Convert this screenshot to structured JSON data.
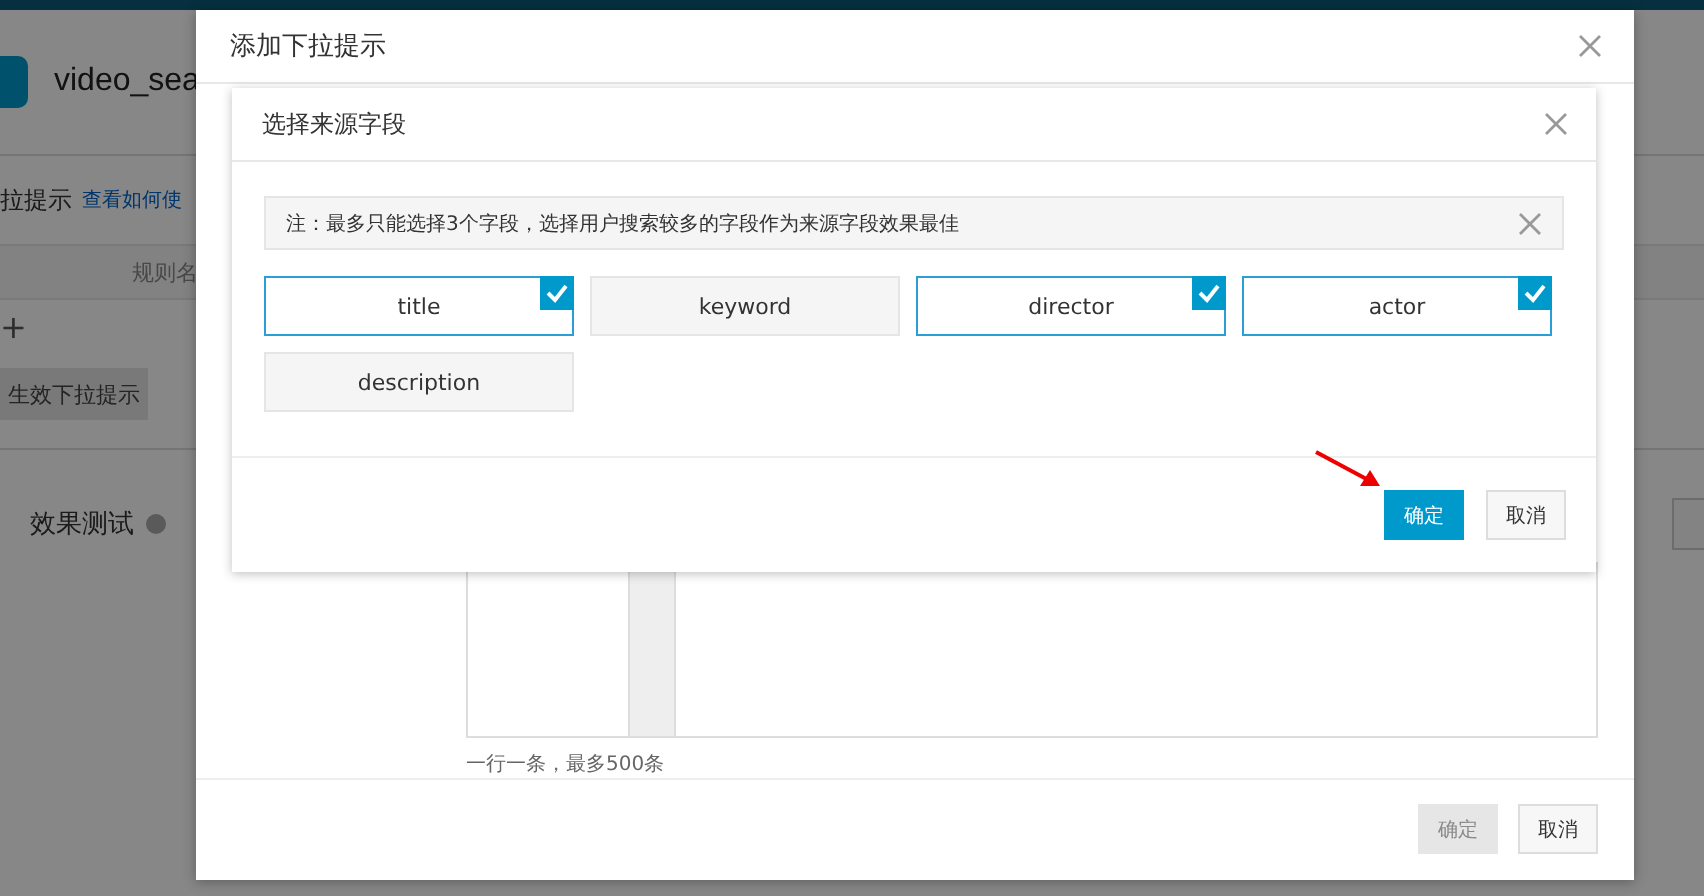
{
  "background_page": {
    "project_name": "video_sea",
    "section_title": "拉提示",
    "help_link": "查看如何使",
    "column_header": "规则名",
    "add_symbol": "+",
    "publish_button": {
      "label": "生效下拉提示",
      "disabled": true
    },
    "test_label": "效果测试"
  },
  "outer_dialog": {
    "title": "添加下拉提示",
    "textarea_hint": "一行一条，最多500条",
    "buttons": [
      {
        "label": "确定",
        "kind": "primary",
        "disabled": true
      },
      {
        "label": "取消",
        "kind": "default"
      }
    ]
  },
  "inner_dialog": {
    "title": "选择来源字段",
    "note": "注：最多只能选择3个字段，选择用户搜索较多的字段作为来源字段效果最佳",
    "fields": [
      {
        "label": "title",
        "checked": true
      },
      {
        "label": "keyword",
        "checked": false
      },
      {
        "label": "director",
        "checked": true
      },
      {
        "label": "actor",
        "checked": true
      },
      {
        "label": "description",
        "checked": false
      }
    ],
    "buttons": [
      {
        "label": "确定",
        "kind": "primary",
        "disabled": false
      },
      {
        "label": "取消",
        "kind": "default"
      }
    ]
  }
}
